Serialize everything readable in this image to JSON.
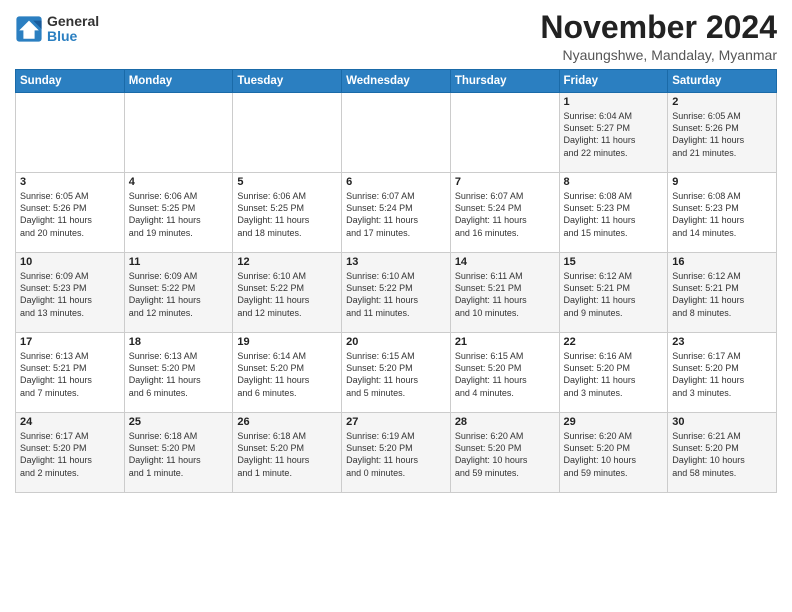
{
  "logo": {
    "general": "General",
    "blue": "Blue"
  },
  "title": "November 2024",
  "location": "Nyaungshwe, Mandalay, Myanmar",
  "days_header": [
    "Sunday",
    "Monday",
    "Tuesday",
    "Wednesday",
    "Thursday",
    "Friday",
    "Saturday"
  ],
  "weeks": [
    [
      {
        "day": "",
        "detail": ""
      },
      {
        "day": "",
        "detail": ""
      },
      {
        "day": "",
        "detail": ""
      },
      {
        "day": "",
        "detail": ""
      },
      {
        "day": "",
        "detail": ""
      },
      {
        "day": "1",
        "detail": "Sunrise: 6:04 AM\nSunset: 5:27 PM\nDaylight: 11 hours\nand 22 minutes."
      },
      {
        "day": "2",
        "detail": "Sunrise: 6:05 AM\nSunset: 5:26 PM\nDaylight: 11 hours\nand 21 minutes."
      }
    ],
    [
      {
        "day": "3",
        "detail": "Sunrise: 6:05 AM\nSunset: 5:26 PM\nDaylight: 11 hours\nand 20 minutes."
      },
      {
        "day": "4",
        "detail": "Sunrise: 6:06 AM\nSunset: 5:25 PM\nDaylight: 11 hours\nand 19 minutes."
      },
      {
        "day": "5",
        "detail": "Sunrise: 6:06 AM\nSunset: 5:25 PM\nDaylight: 11 hours\nand 18 minutes."
      },
      {
        "day": "6",
        "detail": "Sunrise: 6:07 AM\nSunset: 5:24 PM\nDaylight: 11 hours\nand 17 minutes."
      },
      {
        "day": "7",
        "detail": "Sunrise: 6:07 AM\nSunset: 5:24 PM\nDaylight: 11 hours\nand 16 minutes."
      },
      {
        "day": "8",
        "detail": "Sunrise: 6:08 AM\nSunset: 5:23 PM\nDaylight: 11 hours\nand 15 minutes."
      },
      {
        "day": "9",
        "detail": "Sunrise: 6:08 AM\nSunset: 5:23 PM\nDaylight: 11 hours\nand 14 minutes."
      }
    ],
    [
      {
        "day": "10",
        "detail": "Sunrise: 6:09 AM\nSunset: 5:23 PM\nDaylight: 11 hours\nand 13 minutes."
      },
      {
        "day": "11",
        "detail": "Sunrise: 6:09 AM\nSunset: 5:22 PM\nDaylight: 11 hours\nand 12 minutes."
      },
      {
        "day": "12",
        "detail": "Sunrise: 6:10 AM\nSunset: 5:22 PM\nDaylight: 11 hours\nand 12 minutes."
      },
      {
        "day": "13",
        "detail": "Sunrise: 6:10 AM\nSunset: 5:22 PM\nDaylight: 11 hours\nand 11 minutes."
      },
      {
        "day": "14",
        "detail": "Sunrise: 6:11 AM\nSunset: 5:21 PM\nDaylight: 11 hours\nand 10 minutes."
      },
      {
        "day": "15",
        "detail": "Sunrise: 6:12 AM\nSunset: 5:21 PM\nDaylight: 11 hours\nand 9 minutes."
      },
      {
        "day": "16",
        "detail": "Sunrise: 6:12 AM\nSunset: 5:21 PM\nDaylight: 11 hours\nand 8 minutes."
      }
    ],
    [
      {
        "day": "17",
        "detail": "Sunrise: 6:13 AM\nSunset: 5:21 PM\nDaylight: 11 hours\nand 7 minutes."
      },
      {
        "day": "18",
        "detail": "Sunrise: 6:13 AM\nSunset: 5:20 PM\nDaylight: 11 hours\nand 6 minutes."
      },
      {
        "day": "19",
        "detail": "Sunrise: 6:14 AM\nSunset: 5:20 PM\nDaylight: 11 hours\nand 6 minutes."
      },
      {
        "day": "20",
        "detail": "Sunrise: 6:15 AM\nSunset: 5:20 PM\nDaylight: 11 hours\nand 5 minutes."
      },
      {
        "day": "21",
        "detail": "Sunrise: 6:15 AM\nSunset: 5:20 PM\nDaylight: 11 hours\nand 4 minutes."
      },
      {
        "day": "22",
        "detail": "Sunrise: 6:16 AM\nSunset: 5:20 PM\nDaylight: 11 hours\nand 3 minutes."
      },
      {
        "day": "23",
        "detail": "Sunrise: 6:17 AM\nSunset: 5:20 PM\nDaylight: 11 hours\nand 3 minutes."
      }
    ],
    [
      {
        "day": "24",
        "detail": "Sunrise: 6:17 AM\nSunset: 5:20 PM\nDaylight: 11 hours\nand 2 minutes."
      },
      {
        "day": "25",
        "detail": "Sunrise: 6:18 AM\nSunset: 5:20 PM\nDaylight: 11 hours\nand 1 minute."
      },
      {
        "day": "26",
        "detail": "Sunrise: 6:18 AM\nSunset: 5:20 PM\nDaylight: 11 hours\nand 1 minute."
      },
      {
        "day": "27",
        "detail": "Sunrise: 6:19 AM\nSunset: 5:20 PM\nDaylight: 11 hours\nand 0 minutes."
      },
      {
        "day": "28",
        "detail": "Sunrise: 6:20 AM\nSunset: 5:20 PM\nDaylight: 10 hours\nand 59 minutes."
      },
      {
        "day": "29",
        "detail": "Sunrise: 6:20 AM\nSunset: 5:20 PM\nDaylight: 10 hours\nand 59 minutes."
      },
      {
        "day": "30",
        "detail": "Sunrise: 6:21 AM\nSunset: 5:20 PM\nDaylight: 10 hours\nand 58 minutes."
      }
    ]
  ]
}
